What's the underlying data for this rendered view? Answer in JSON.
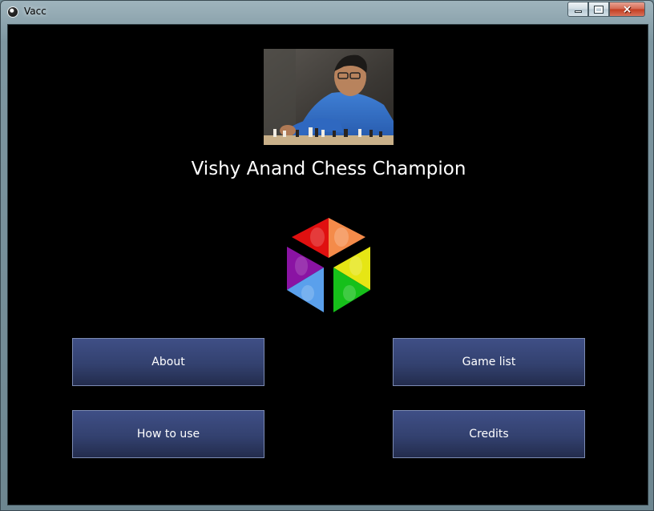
{
  "window": {
    "title": "Vacc",
    "icon": "app-icon",
    "controls": {
      "minimize": "minimize-icon",
      "maximize": "maximize-icon",
      "close": "×"
    }
  },
  "main": {
    "heading": "Vishy Anand Chess Champion",
    "photo": "champion-photo",
    "logo": "cube-logo",
    "buttons": {
      "about": "About",
      "game_list": "Game list",
      "how_to_use": "How to use",
      "credits": "Credits"
    }
  },
  "colors": {
    "background": "#000000",
    "button_top": "#3f4f86",
    "button_bottom": "#232c4d",
    "button_border": "#7c8bb3",
    "text": "#ffffff",
    "close_button": "#c23c1f"
  }
}
